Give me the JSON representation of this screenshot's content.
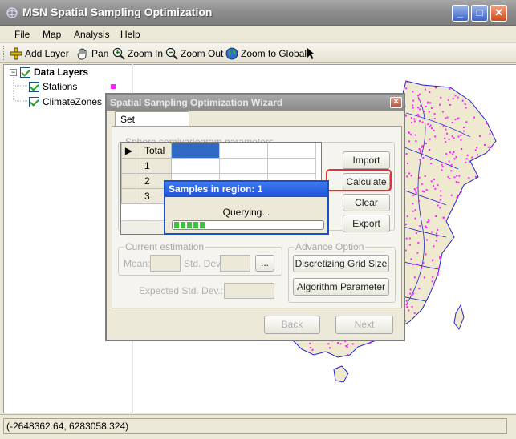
{
  "window": {
    "title": "MSN Spatial Sampling Optimization",
    "min_label": "_",
    "max_label": "□",
    "close_label": "✕"
  },
  "menu": [
    "File",
    "Map",
    "Analysis",
    "Help"
  ],
  "toolbar": {
    "add_layer": "Add Layer",
    "pan": "Pan",
    "zoom_in": "Zoom In",
    "zoom_out": "Zoom Out",
    "zoom_global": "Zoom to Global"
  },
  "layers": {
    "root": "Data Layers",
    "items": [
      "Stations",
      "ClimateZones"
    ],
    "station_color": "#ff22ff"
  },
  "wizard": {
    "title": "Spatial Sampling Optimization Wizard",
    "tab": "Set Parameters",
    "semivariogram_group": "Sphere semivariogram parameters",
    "rows": [
      "Total",
      "1",
      "2",
      "3"
    ],
    "buttons": {
      "import": "Import",
      "calculate": "Calculate",
      "clear": "Clear",
      "export": "Export"
    },
    "estimation_group": "Current estimation",
    "mean_label": "Mean:",
    "std_label": "Std. Dev:",
    "browse": "...",
    "expected_label": "Expected Std. Dev.:",
    "advance_group": "Advance Option",
    "grid_size_button": "Discretizing Grid Size",
    "algorithm_button": "Algorithm Parameter",
    "back": "Back",
    "next": "Next"
  },
  "progress": {
    "title": "Samples in region: 1",
    "status": "Querying...",
    "value_percent": 22
  },
  "status": {
    "coords": "(-2648362.64, 6283058.324)"
  },
  "colors": {
    "map_fill": "#efe9cf",
    "map_border": "#2323d2",
    "station_dot": "#ff22ff",
    "selection": "#316ac5"
  }
}
